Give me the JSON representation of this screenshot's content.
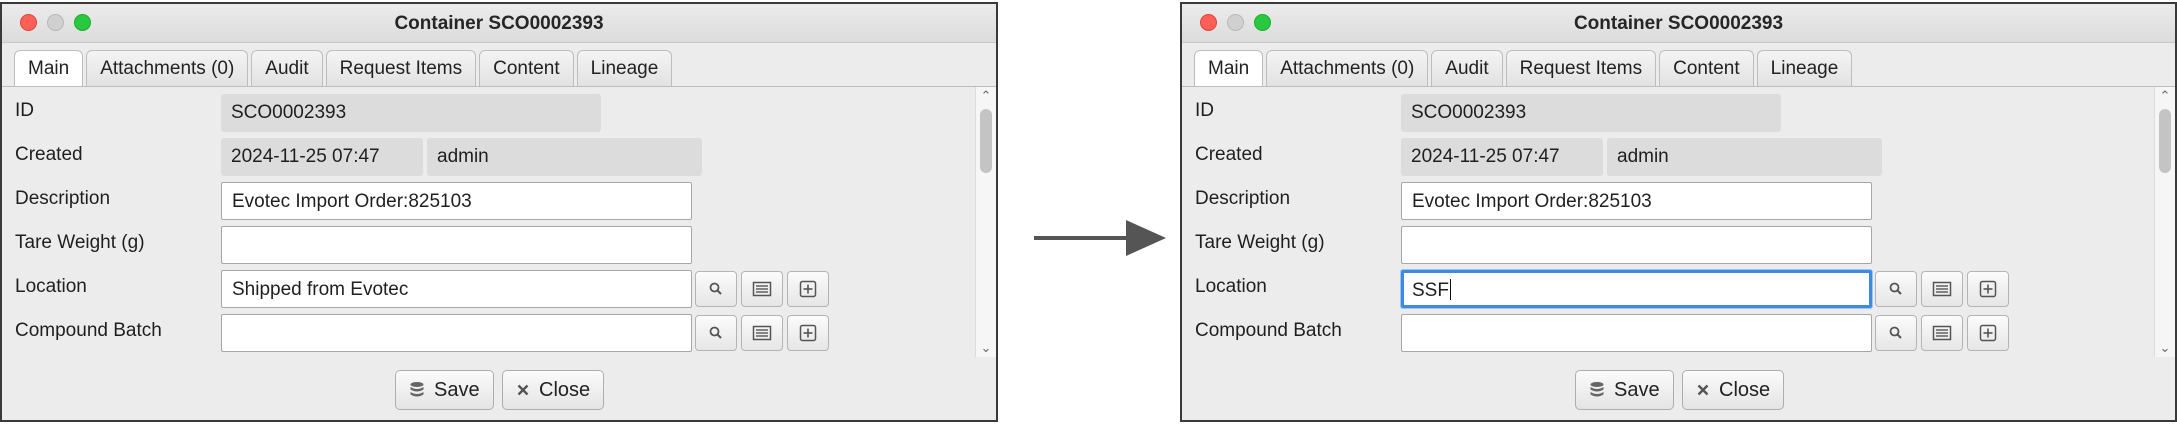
{
  "arrow_icon": "right-arrow",
  "before": {
    "window_title": "Container SCO0002393",
    "tabs": [
      "Main",
      "Attachments (0)",
      "Audit",
      "Request Items",
      "Content",
      "Lineage"
    ],
    "fields": {
      "id_label": "ID",
      "id_value": "SCO0002393",
      "created_label": "Created",
      "created_date": "2024-11-25 07:47",
      "created_by": "admin",
      "description_label": "Description",
      "description_value": "Evotec Import Order:825103",
      "tare_label": "Tare Weight (g)",
      "tare_value": "",
      "location_label": "Location",
      "location_value": "Shipped from Evotec",
      "compound_label": "Compound Batch",
      "compound_value": ""
    },
    "buttons": {
      "save": "Save",
      "close": "Close"
    }
  },
  "after": {
    "window_title": "Container SCO0002393",
    "tabs": [
      "Main",
      "Attachments (0)",
      "Audit",
      "Request Items",
      "Content",
      "Lineage"
    ],
    "fields": {
      "id_label": "ID",
      "id_value": "SCO0002393",
      "created_label": "Created",
      "created_date": "2024-11-25 07:47",
      "created_by": "admin",
      "description_label": "Description",
      "description_value": "Evotec Import Order:825103",
      "tare_label": "Tare Weight (g)",
      "tare_value": "",
      "location_label": "Location",
      "location_value": "SSF",
      "compound_label": "Compound Batch",
      "compound_value": ""
    },
    "buttons": {
      "save": "Save",
      "close": "Close"
    }
  },
  "icons": {
    "search": "search-icon",
    "list": "list-icon",
    "add": "add-icon",
    "save": "database-icon",
    "close": "close-icon"
  },
  "colors": {
    "focus_ring": "#3d8be0",
    "readonly_bg": "#dcdcdc",
    "close_light": "#fe5f57",
    "zoom_light": "#28c840"
  }
}
